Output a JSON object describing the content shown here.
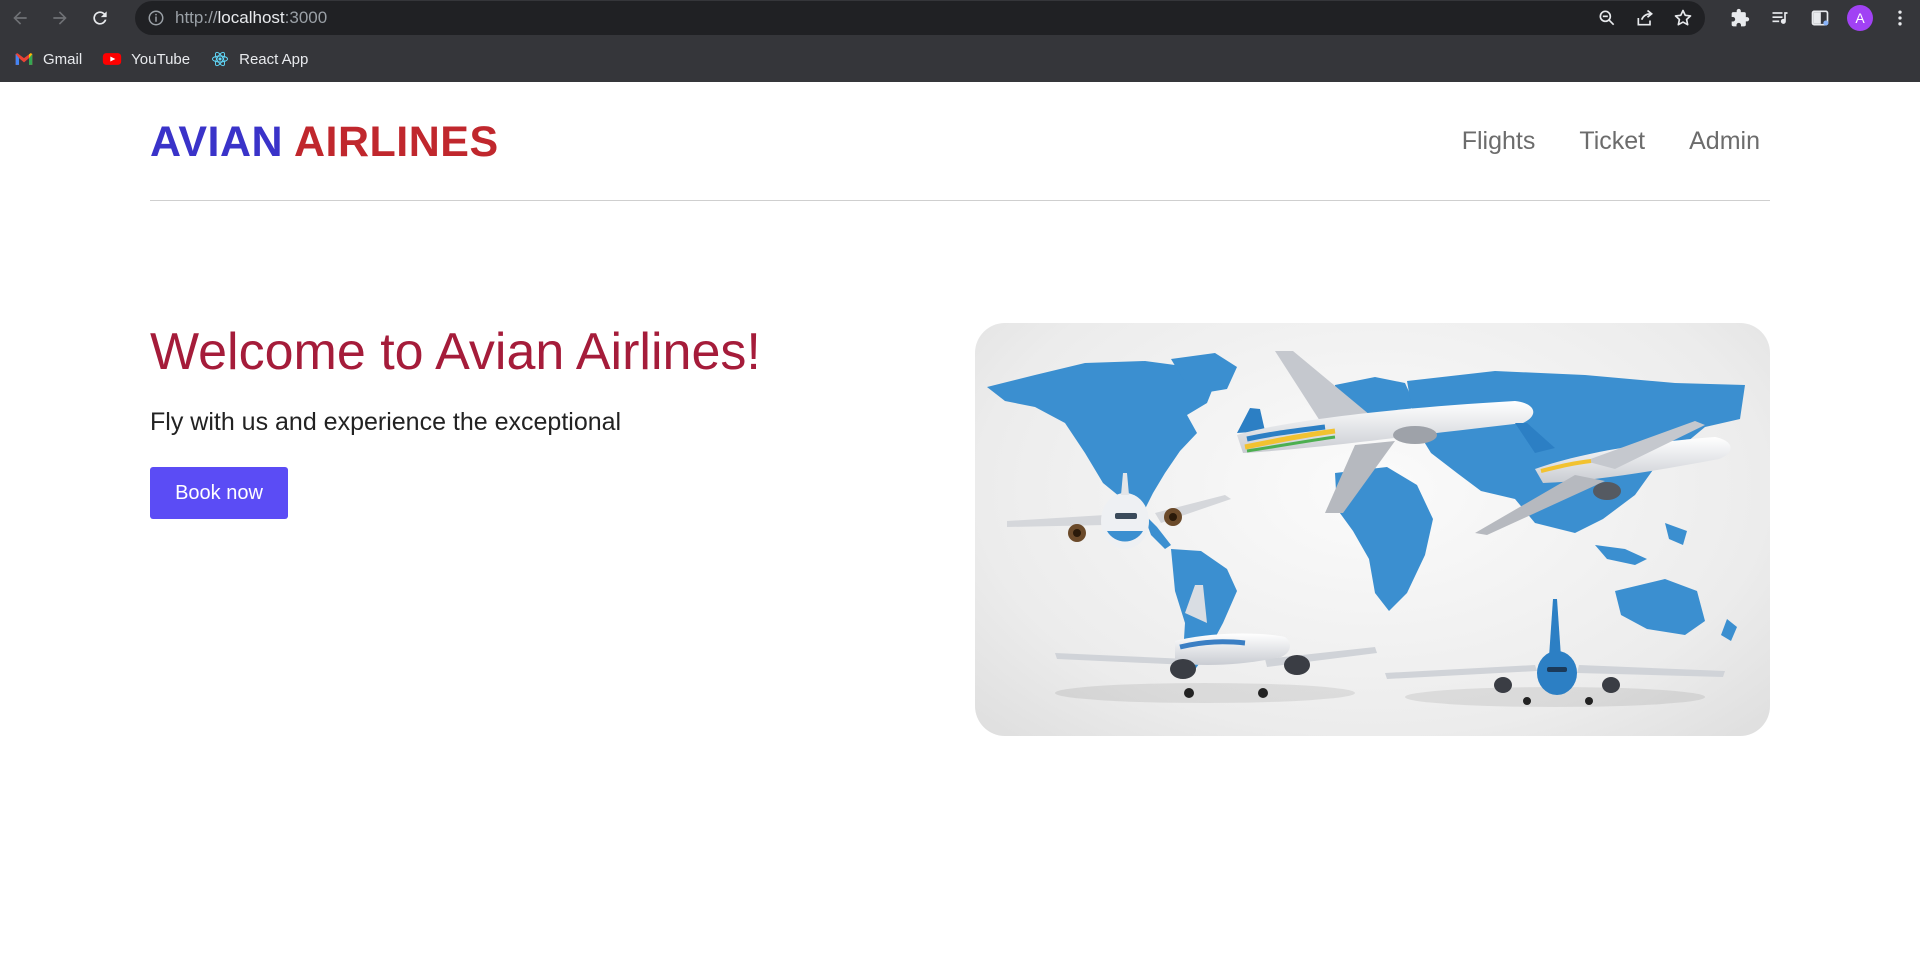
{
  "browser": {
    "url_scheme": "http://",
    "url_host": "localhost",
    "url_port": ":3000",
    "bookmarks": [
      {
        "label": "Gmail",
        "icon": "gmail-icon"
      },
      {
        "label": "YouTube",
        "icon": "youtube-icon"
      },
      {
        "label": "React App",
        "icon": "react-icon"
      }
    ],
    "profile_initial": "A",
    "profile_color": "#a142f4"
  },
  "header": {
    "logo_part1": "AVIAN",
    "logo_part2": "AIRLINES",
    "logo_color1": "#3a33c9",
    "logo_color2": "#c0272d",
    "nav": [
      {
        "label": "Flights"
      },
      {
        "label": "Ticket"
      },
      {
        "label": "Admin"
      }
    ]
  },
  "hero": {
    "title": "Welcome to Avian Airlines!",
    "subtitle": "Fly with us and experience the exceptional",
    "button_label": "Book now",
    "button_color": "#5b4cf5",
    "title_color": "#a51c3a",
    "image": "world-map-with-airplanes"
  }
}
